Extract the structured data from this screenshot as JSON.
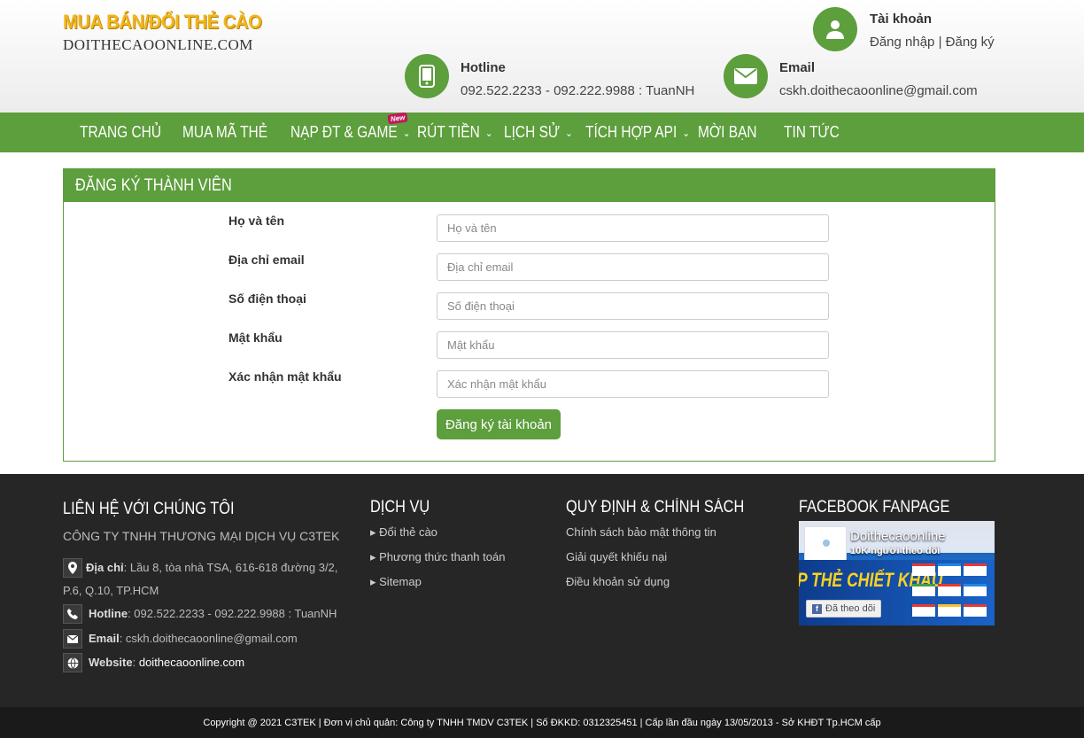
{
  "header": {
    "logo_title": "MUA BÁN/ĐỔI THẺ CÀO",
    "logo_sub": "DOITHECAOONLINE.COM",
    "account": {
      "label": "Tài khoản",
      "login": "Đăng nhập",
      "separator": " | ",
      "register": "Đăng ký"
    },
    "hotline": {
      "label": "Hotline",
      "value": "092.522.2233 - 092.222.9988 : TuanNH"
    },
    "email": {
      "label": "Email",
      "value": "cskh.doithecaoonline@gmail.com"
    }
  },
  "nav": {
    "items": [
      {
        "label": "TRANG CHỦ"
      },
      {
        "label": "MUA MÃ THẺ"
      },
      {
        "label": "NẠP ĐT & GAME"
      },
      {
        "label": "RÚT TIỀN"
      },
      {
        "label": "LỊCH SỬ"
      },
      {
        "label": "TÍCH HỢP API"
      },
      {
        "label": "MỜI BẠN"
      },
      {
        "label": "TIN TỨC"
      }
    ],
    "new_badge": "New"
  },
  "register": {
    "title": "ĐĂNG KÝ THÀNH VIÊN",
    "fields": [
      {
        "label": "Họ và tên",
        "placeholder": "Họ và tên"
      },
      {
        "label": "Địa chỉ email",
        "placeholder": "Địa chỉ email"
      },
      {
        "label": "Số điện thoại",
        "placeholder": "Số điện thoại"
      },
      {
        "label": "Mật khẩu",
        "placeholder": "Mật khẩu"
      },
      {
        "label": "Xác nhận mật khẩu",
        "placeholder": "Xác nhận mật khẩu"
      }
    ],
    "submit": "Đăng ký tài khoản"
  },
  "footer": {
    "contact": {
      "heading": "LIÊN HỆ VỚI CHÚNG TÔI",
      "company": "CÔNG TY TNHH THƯƠNG MẠI DỊCH VỤ C3TEK",
      "address_label": "Địa chỉ",
      "address_line1": ": Lầu 8, tòa nhà TSA, 616-618 đường 3/2,",
      "address_line2": "P.6, Q.10, TP.HCM",
      "hotline_label": "Hotline",
      "hotline_value": ": 092.522.2233 - 092.222.9988 : TuanNH",
      "email_label": "Email",
      "email_value": ": cskh.doithecaoonline@gmail.com",
      "website_label": "Website",
      "website_sep": ": ",
      "website_value": "doithecaoonline.com"
    },
    "services": {
      "heading": "DỊCH VỤ",
      "items": [
        "Đổi thẻ cào",
        "Phương thức thanh toán",
        "Sitemap"
      ]
    },
    "policy": {
      "heading": "QUY ĐỊNH & CHÍNH SÁCH",
      "items": [
        "Chính sách bảo mật thông tin",
        "Giải quyết khiếu nại",
        "Điều khoản sử dụng"
      ]
    },
    "facebook": {
      "heading": "FACEBOOK FANPAGE",
      "page_name": "Doithecaoonline",
      "followers": "10K người theo dõi",
      "follow_button": "Đã theo dõi",
      "banner_text": "P THẺ CHIẾT KHẤU"
    },
    "copyright": "Copyright @ 2021 C3TEK | Đơn vị chủ quản: Công ty TNHH TMDV C3TEK | Số ĐKKD: 0312325451 | Cấp lần đầu ngày 13/05/2013 - Sở KHĐT Tp.HCM cấp"
  }
}
